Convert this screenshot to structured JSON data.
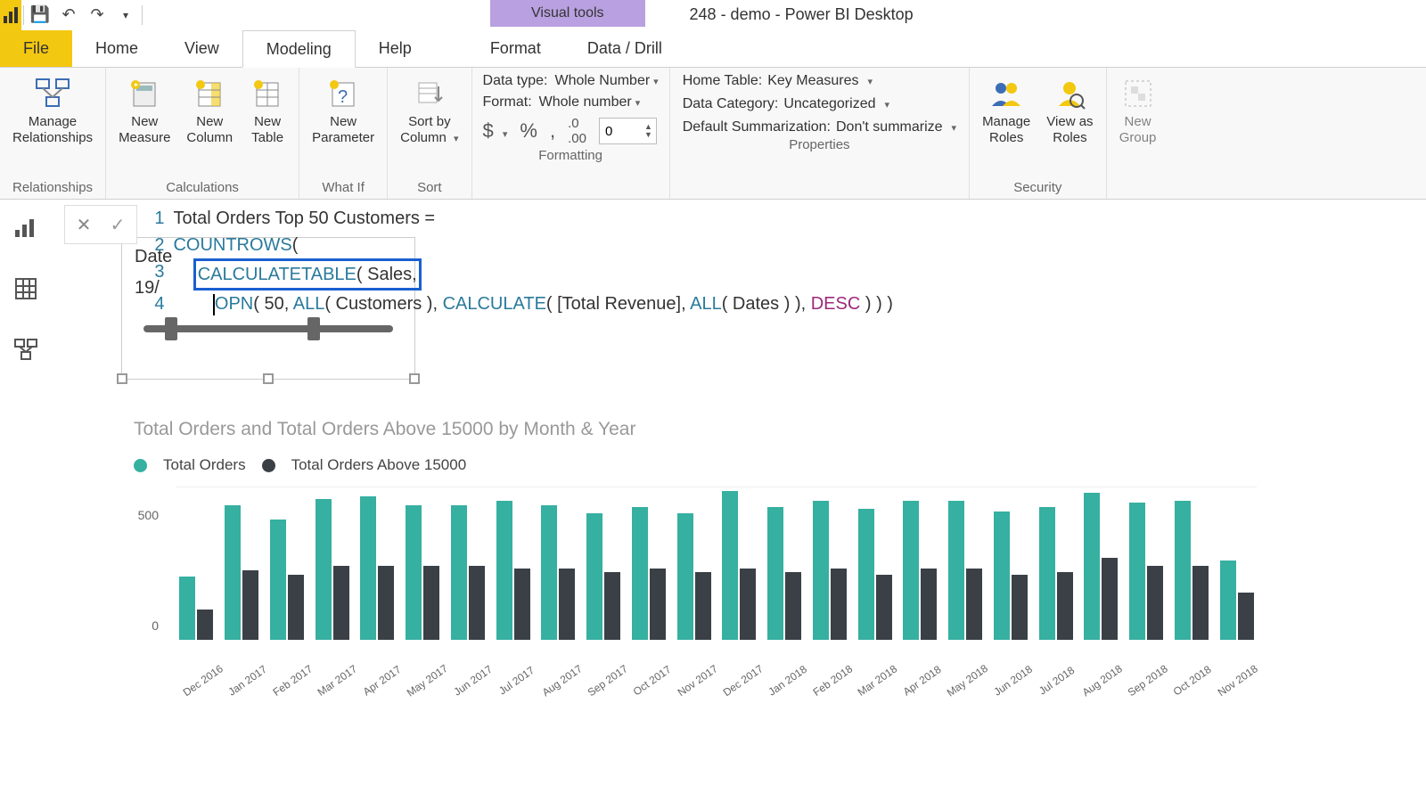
{
  "window_title": "248 - demo - Power BI Desktop",
  "contextual_tab": "Visual tools",
  "tabs": {
    "file": "File",
    "home": "Home",
    "view": "View",
    "modeling": "Modeling",
    "help": "Help",
    "format": "Format",
    "data_drill": "Data / Drill"
  },
  "ribbon": {
    "relationships": {
      "manage": "Manage\nRelationships",
      "group": "Relationships"
    },
    "calculations": {
      "measure": "New\nMeasure",
      "column": "New\nColumn",
      "table": "New\nTable",
      "group": "Calculations"
    },
    "whatif": {
      "param": "New\nParameter",
      "group": "What If"
    },
    "sort": {
      "sort": "Sort by\nColumn",
      "group": "Sort"
    },
    "formatting": {
      "datatype_label": "Data type:",
      "datatype_value": "Whole Number",
      "format_label": "Format:",
      "format_value": "Whole number",
      "decimals": "0",
      "group": "Formatting"
    },
    "properties": {
      "home_table_label": "Home Table:",
      "home_table_value": "Key Measures",
      "category_label": "Data Category:",
      "category_value": "Uncategorized",
      "summarization_label": "Default Summarization:",
      "summarization_value": "Don't summarize",
      "group": "Properties"
    },
    "security": {
      "manage_roles": "Manage\nRoles",
      "view_as": "View as\nRoles",
      "group": "Security"
    },
    "groups": {
      "new_group": "New\nGroup"
    }
  },
  "slicer": {
    "label": "Date",
    "value": "19/"
  },
  "formula": {
    "l1": "Total Orders Top 50 Customers = ",
    "l2_a": "COUNTROWS",
    "l2_b": "(",
    "l3_box_a": "CALCULATETABLE",
    "l3_box_b": "( Sales,",
    "l4_a": "OPN",
    "l4_b": "( 50, ",
    "l4_c": "ALL",
    "l4_d": "( Customers ), ",
    "l4_e": "CALCULATE",
    "l4_f": "( [Total Revenue], ",
    "l4_g": "ALL",
    "l4_h": "( Dates ) ), ",
    "l4_i": "DESC",
    "l4_j": " ) ) )"
  },
  "chart_title": "Total Orders and Total Orders Above 15000 by Month & Year",
  "legend": {
    "s1": "Total Orders",
    "s2": "Total Orders Above 15000"
  },
  "yticks": {
    "t500": "500",
    "t0": "0"
  },
  "chart_colors": {
    "s1": "#36b0a0",
    "s2": "#3a4046"
  },
  "chart_data": {
    "type": "bar",
    "title": "Total Orders and Total Orders Above 15000 by Month & Year",
    "xlabel": "",
    "ylabel": "",
    "ylim": [
      0,
      750
    ],
    "categories": [
      "Dec 2016",
      "Jan 2017",
      "Feb 2017",
      "Mar 2017",
      "Apr 2017",
      "May 2017",
      "Jun 2017",
      "Jul 2017",
      "Aug 2017",
      "Sep 2017",
      "Oct 2017",
      "Nov 2017",
      "Dec 2017",
      "Jan 2018",
      "Feb 2018",
      "Mar 2018",
      "Apr 2018",
      "May 2018",
      "Jun 2018",
      "Jul 2018",
      "Aug 2018",
      "Sep 2018",
      "Oct 2018",
      "Nov 2018"
    ],
    "series": [
      {
        "name": "Total Orders",
        "values": [
          310,
          660,
          590,
          690,
          700,
          660,
          660,
          680,
          660,
          620,
          650,
          620,
          730,
          650,
          680,
          640,
          680,
          680,
          630,
          650,
          720,
          670,
          680,
          390
        ]
      },
      {
        "name": "Total Orders Above 15000",
        "values": [
          150,
          340,
          320,
          360,
          360,
          360,
          360,
          350,
          350,
          330,
          350,
          330,
          350,
          330,
          350,
          320,
          350,
          350,
          320,
          330,
          400,
          360,
          360,
          230
        ]
      }
    ]
  }
}
